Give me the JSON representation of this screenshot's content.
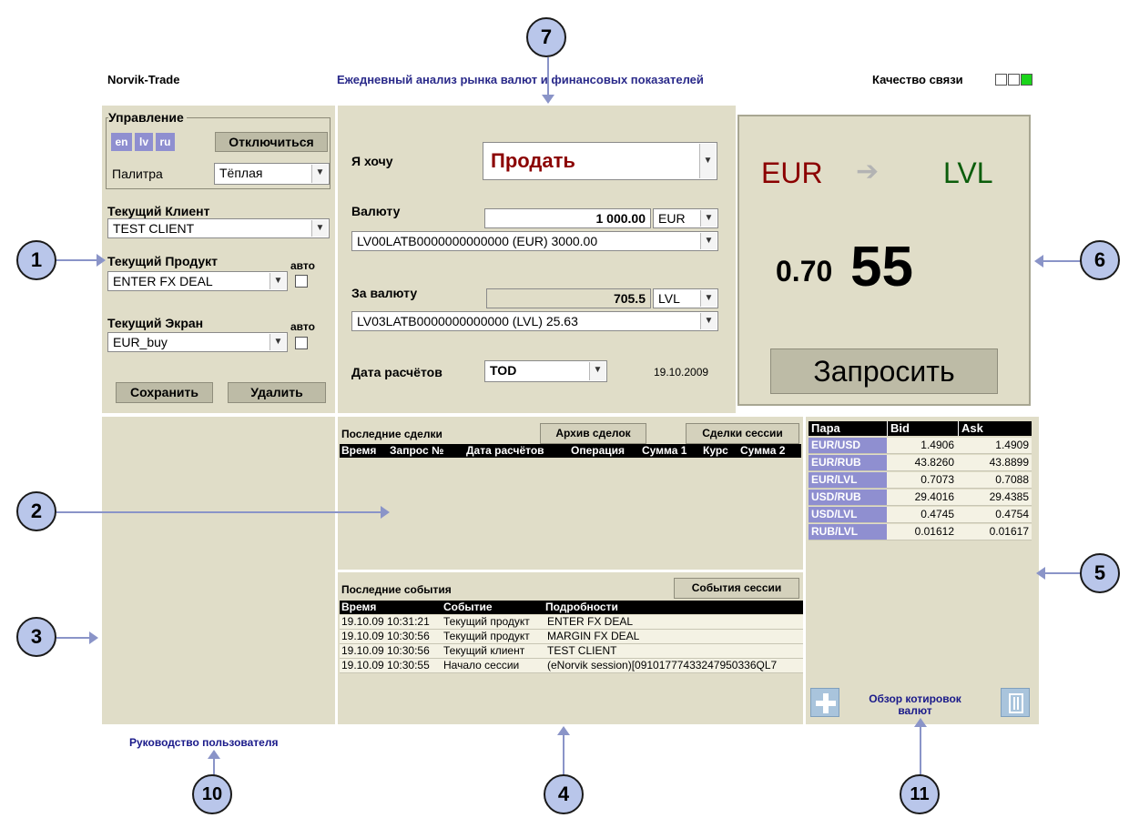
{
  "app": {
    "title": "Norvik-Trade",
    "banner": "Ежедневный анализ рынка валют и финансовых показателей",
    "connection_label": "Качество связи"
  },
  "control": {
    "legend": "Управление",
    "languages": [
      "en",
      "lv",
      "ru"
    ],
    "disconnect_label": "Отключиться",
    "palette_label": "Палитра",
    "palette_value": "Тёплая"
  },
  "client": {
    "label": "Текущий Клиент",
    "value": "TEST CLIENT"
  },
  "product": {
    "label": "Текущий Продукт",
    "auto_label": "авто",
    "value": "ENTER FX DEAL"
  },
  "screen": {
    "label": "Текущий Экран",
    "auto_label": "авто",
    "value": "EUR_buy"
  },
  "actions": {
    "save_label": "Сохранить",
    "delete_label": "Удалить"
  },
  "deal": {
    "want_label": "Я хочу",
    "want_value": "Продать",
    "currency_label": "Валюту",
    "amount": "1 000.00",
    "amount_currency": "EUR",
    "account_from": "LV00LATB0000000000000 (EUR) 3000.00",
    "for_currency_label": "За валюту",
    "for_amount": "705.5",
    "for_currency": "LVL",
    "account_to": "LV03LATB0000000000000 (LVL) 25.63",
    "settlement_label": "Дата расчётов",
    "settlement_value": "TOD",
    "settlement_date": "19.10.2009"
  },
  "rate": {
    "from_currency": "EUR",
    "to_currency": "LVL",
    "rate_small": "0.70",
    "rate_big": "55",
    "request_label": "Запросить",
    "from_color": "#8b0000",
    "to_color": "#0b5d0b"
  },
  "trades": {
    "title": "Последние сделки",
    "archive_label": "Архив сделок",
    "session_label": "Сделки сессии",
    "columns": [
      "Время",
      "Запрос №",
      "Дата расчётов",
      "Операция",
      "Сумма 1",
      "Курс",
      "Сумма 2"
    ]
  },
  "events": {
    "title": "Последние события",
    "session_label": "События сессии",
    "columns": [
      "Время",
      "Событие",
      "Подробности"
    ],
    "rows": [
      [
        "19.10.09 10:31:21",
        "Текущий продукт",
        "ENTER FX DEAL"
      ],
      [
        "19.10.09 10:30:56",
        "Текущий продукт",
        "MARGIN FX DEAL"
      ],
      [
        "19.10.09 10:30:56",
        "Текущий клиент",
        "TEST CLIENT"
      ],
      [
        "19.10.09 10:30:55",
        "Начало сессии",
        "(eNorvik session)[0910177743324795033​6QL7"
      ]
    ]
  },
  "quotes": {
    "columns": [
      "Пара",
      "Bid",
      "Ask"
    ],
    "rows": [
      [
        "EUR/USD",
        "1.4906",
        "1.4909"
      ],
      [
        "EUR/RUB",
        "43.8260",
        "43.8899"
      ],
      [
        "EUR/LVL",
        "0.7073",
        "0.7088"
      ],
      [
        "USD/RUB",
        "29.4016",
        "29.4385"
      ],
      [
        "USD/LVL",
        "0.4745",
        "0.4754"
      ],
      [
        "RUB/LVL",
        "0.01612",
        "0.01617"
      ]
    ],
    "overview_label": "Обзор котировок валют"
  },
  "footer": {
    "guide_link": "Руководство пользователя"
  },
  "callouts": [
    "1",
    "2",
    "3",
    "4",
    "5",
    "6",
    "7",
    "10",
    "11"
  ]
}
